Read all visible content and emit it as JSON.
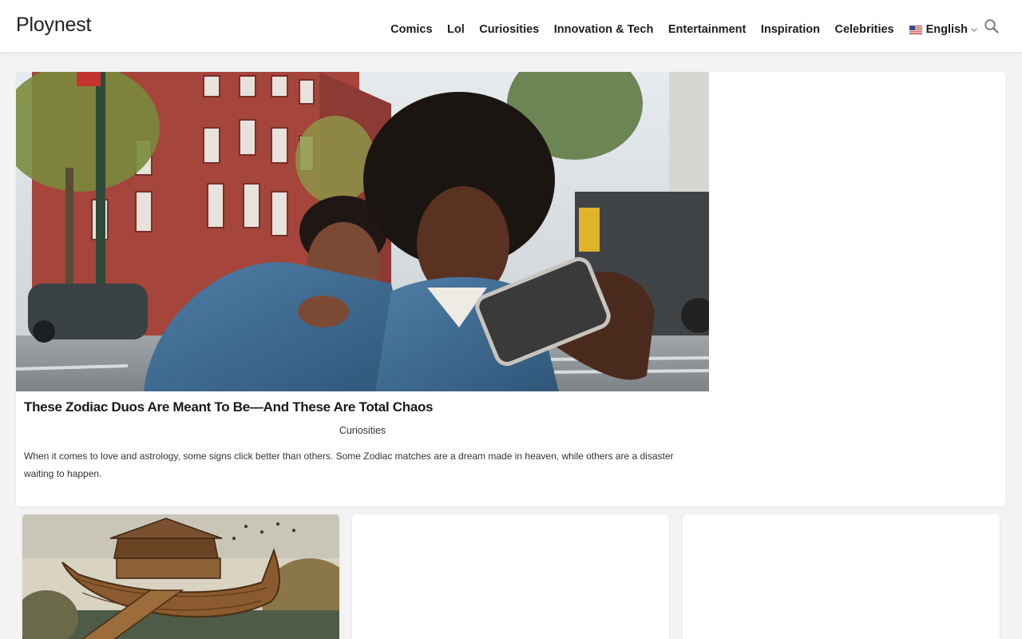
{
  "site": {
    "logo": "Ploynest"
  },
  "nav": {
    "items": [
      {
        "label": "Comics"
      },
      {
        "label": "Lol"
      },
      {
        "label": "Curiosities"
      },
      {
        "label": "Innovation & Tech"
      },
      {
        "label": "Entertainment"
      },
      {
        "label": "Inspiration"
      },
      {
        "label": "Celebrities"
      }
    ],
    "language": {
      "label": "English",
      "flag_icon": "us-flag-icon",
      "chevron_icon": "chevron-down-icon"
    },
    "search_icon": "search-icon"
  },
  "featured": {
    "title": "These Zodiac Duos Are Meant To Be—And These Are Total Chaos",
    "category": "Curiosities",
    "description": "When it comes to love and astrology, some signs click better than others. Some Zodiac matches are a dream made in heaven, while others are a disaster waiting to happen.",
    "image": "photo of two people in denim jackets taking a selfie on a city street"
  },
  "cards": [
    {
      "image": "painting of Noah's ark with animals"
    },
    {
      "image": ""
    },
    {
      "image": ""
    }
  ],
  "colors": {
    "page_bg": "#f3f3f3",
    "card_bg": "#ffffff",
    "text": "#1e1e1e"
  }
}
